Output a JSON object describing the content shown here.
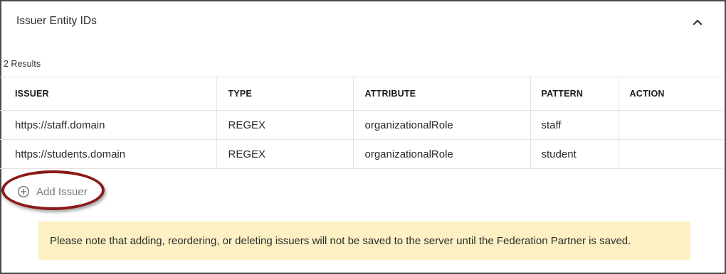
{
  "panel": {
    "title": "Issuer Entity IDs",
    "collapse_icon": "chevron-up-icon"
  },
  "results": {
    "count_text": "2 Results"
  },
  "table": {
    "headers": [
      "ISSUER",
      "TYPE",
      "ATTRIBUTE",
      "PATTERN",
      "ACTION"
    ],
    "rows": [
      {
        "issuer": "https://staff.domain",
        "type": "REGEX",
        "attribute": "organizationalRole",
        "pattern": "staff",
        "action": ""
      },
      {
        "issuer": "https://students.domain",
        "type": "REGEX",
        "attribute": "organizationalRole",
        "pattern": "student",
        "action": ""
      }
    ]
  },
  "add_issuer": {
    "label": "Add Issuer",
    "icon": "plus-circle-icon",
    "highlight_color": "#8b1a1a"
  },
  "notice": {
    "text": "Please note that adding, reordering, or deleting issuers will not be saved to the server until the Federation Partner is saved.",
    "background": "#fdf1c4"
  }
}
